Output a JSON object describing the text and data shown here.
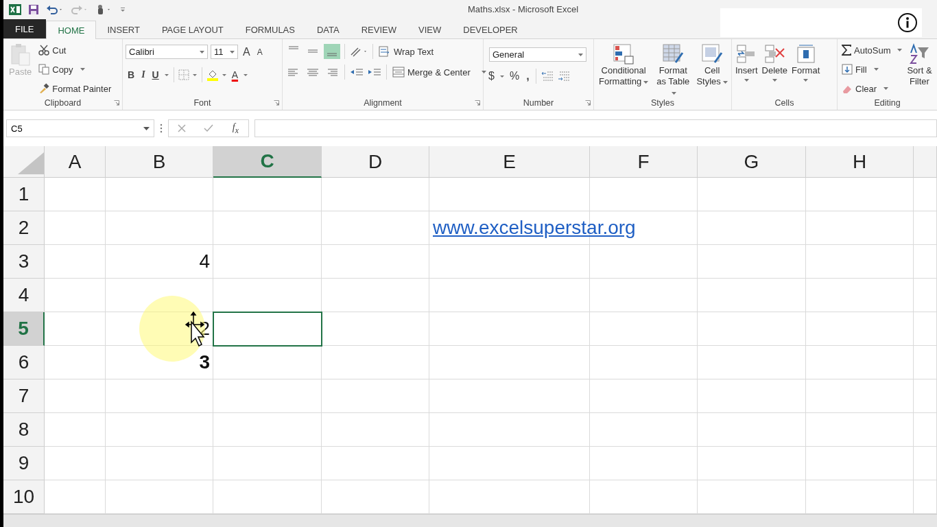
{
  "window": {
    "title": "Maths.xlsx - Microsoft Excel"
  },
  "tabs": [
    {
      "label": "FILE",
      "kind": "file",
      "selected": false
    },
    {
      "label": "HOME",
      "kind": "tab",
      "selected": true
    },
    {
      "label": "INSERT",
      "kind": "tab",
      "selected": false
    },
    {
      "label": "PAGE LAYOUT",
      "kind": "tab",
      "selected": false
    },
    {
      "label": "FORMULAS",
      "kind": "tab",
      "selected": false
    },
    {
      "label": "DATA",
      "kind": "tab",
      "selected": false
    },
    {
      "label": "REVIEW",
      "kind": "tab",
      "selected": false
    },
    {
      "label": "VIEW",
      "kind": "tab",
      "selected": false
    },
    {
      "label": "DEVELOPER",
      "kind": "tab",
      "selected": false
    }
  ],
  "ribbon": [
    {
      "kind": "clipboard",
      "label": "Clipboard",
      "paste": "Paste",
      "paste_disabled": true,
      "cut": "Cut",
      "copy": "Copy",
      "format_painter": "Format Painter"
    },
    {
      "kind": "font",
      "label": "Font",
      "font_name": "Calibri",
      "font_size": "11",
      "grow": "A",
      "shrink": "A",
      "bold": "B",
      "italic": "I",
      "underline": "U",
      "font_color": "A"
    },
    {
      "kind": "alignment",
      "label": "Alignment",
      "vertical": [
        {
          "selected": false
        },
        {
          "selected": false
        },
        {
          "selected": true
        }
      ],
      "wrap_text": "Wrap Text",
      "merge_center": "Merge & Center"
    },
    {
      "kind": "number",
      "label": "Number",
      "format": "General",
      "currency": "$",
      "percent": "%",
      "comma": ","
    },
    {
      "kind": "styles",
      "label": "Styles",
      "buttons": [
        "Conditional Formatting",
        "Format as Table",
        "Cell Styles"
      ]
    },
    {
      "kind": "cells",
      "label": "Cells",
      "buttons": [
        "Insert",
        "Delete",
        "Format"
      ]
    },
    {
      "kind": "editing",
      "label": "Editing",
      "autosum": "AutoSum",
      "fill": "Fill",
      "clear": "Clear",
      "sort_filter": "Sort & Filter"
    }
  ],
  "formula_bar": {
    "name_box": "C5",
    "function_label": "f$_{x}$"
  },
  "sheet": {
    "columns": [
      {
        "label": "A",
        "selected": false
      },
      {
        "label": "B",
        "selected": false
      },
      {
        "label": "C",
        "selected": true
      },
      {
        "label": "D",
        "selected": false
      },
      {
        "label": "E",
        "selected": false
      },
      {
        "label": "F",
        "selected": false
      },
      {
        "label": "G",
        "selected": false
      },
      {
        "label": "H",
        "selected": false
      }
    ],
    "rows": [
      {
        "label": "1",
        "selected": false
      },
      {
        "label": "2",
        "selected": false,
        "cells": {
          "E": {
            "value": "www.excelsuperstar.org",
            "kind": "link"
          }
        }
      },
      {
        "label": "3",
        "selected": false,
        "cells": {
          "B": {
            "value": "4",
            "kind": "number",
            "bold": false
          }
        }
      },
      {
        "label": "4",
        "selected": false
      },
      {
        "label": "5",
        "selected": true,
        "cells": {
          "B": {
            "value": "2",
            "kind": "number",
            "bold": false
          }
        }
      },
      {
        "label": "6",
        "selected": false,
        "cells": {
          "B": {
            "value": "3",
            "kind": "number",
            "bold": true
          }
        }
      },
      {
        "label": "7",
        "selected": false
      },
      {
        "label": "8",
        "selected": false
      },
      {
        "label": "9",
        "selected": false
      },
      {
        "label": "10",
        "selected": false
      }
    ]
  }
}
